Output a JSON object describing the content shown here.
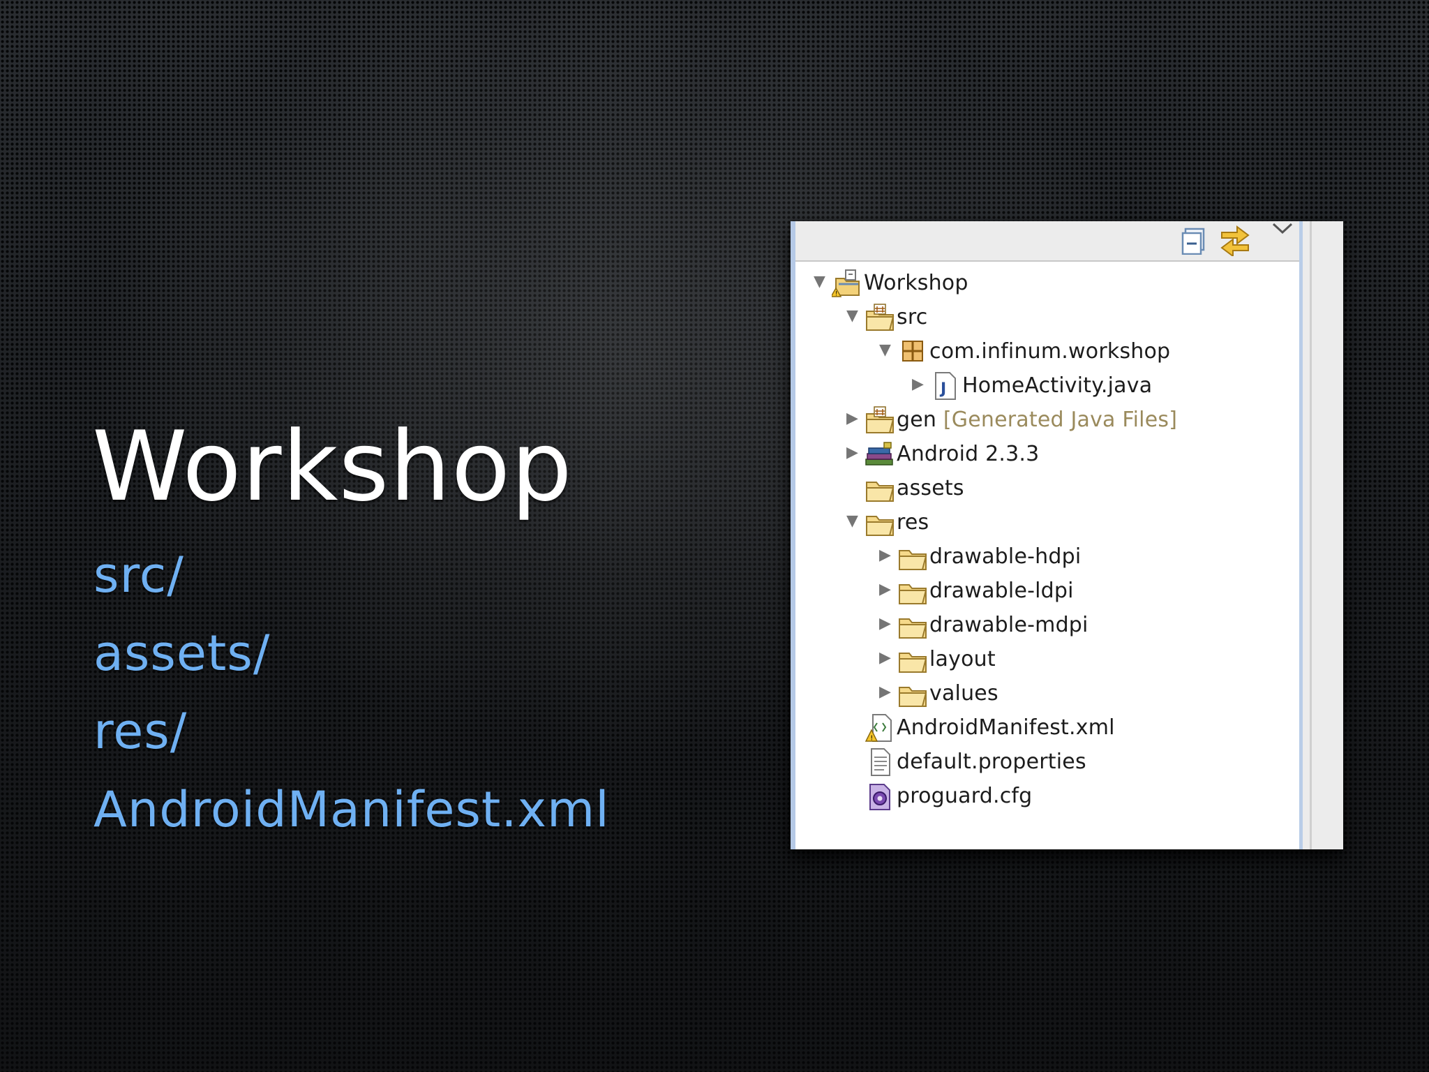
{
  "slide": {
    "title": "Workshop",
    "bullets": [
      "src/",
      "assets/",
      "res/",
      "AndroidManifest.xml"
    ]
  },
  "explorer": {
    "toolbar": {
      "collapse_icon": "collapse-all-icon",
      "link_icon": "link-with-editor-icon",
      "menu_icon": "view-menu-icon"
    },
    "tree": [
      {
        "label": "Workshop",
        "hint": "",
        "icon": "project-icon",
        "expanded": "open"
      },
      {
        "label": "src",
        "hint": "",
        "icon": "source-folder-icon",
        "expanded": "open"
      },
      {
        "label": "com.infinum.workshop",
        "hint": "",
        "icon": "package-icon",
        "expanded": "open"
      },
      {
        "label": "HomeActivity.java",
        "hint": "",
        "icon": "java-file-icon",
        "expanded": "closed"
      },
      {
        "label": "gen",
        "hint": "[Generated Java Files]",
        "icon": "source-folder-icon",
        "expanded": "closed"
      },
      {
        "label": "Android 2.3.3",
        "hint": "",
        "icon": "library-icon",
        "expanded": "closed"
      },
      {
        "label": "assets",
        "hint": "",
        "icon": "folder-icon",
        "expanded": "none"
      },
      {
        "label": "res",
        "hint": "",
        "icon": "folder-icon",
        "expanded": "open"
      },
      {
        "label": "drawable-hdpi",
        "hint": "",
        "icon": "folder-icon",
        "expanded": "closed"
      },
      {
        "label": "drawable-ldpi",
        "hint": "",
        "icon": "folder-icon",
        "expanded": "closed"
      },
      {
        "label": "drawable-mdpi",
        "hint": "",
        "icon": "folder-icon",
        "expanded": "closed"
      },
      {
        "label": "layout",
        "hint": "",
        "icon": "folder-icon",
        "expanded": "closed"
      },
      {
        "label": "values",
        "hint": "",
        "icon": "folder-icon",
        "expanded": "closed"
      },
      {
        "label": "AndroidManifest.xml",
        "hint": "",
        "icon": "xml-file-icon",
        "expanded": "none"
      },
      {
        "label": "default.properties",
        "hint": "",
        "icon": "text-file-icon",
        "expanded": "none"
      },
      {
        "label": "proguard.cfg",
        "hint": "",
        "icon": "config-file-icon",
        "expanded": "none"
      }
    ]
  }
}
